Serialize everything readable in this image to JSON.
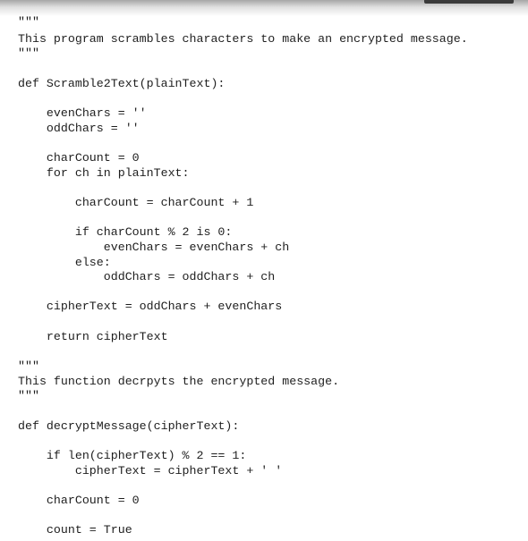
{
  "code": {
    "lines": [
      "\"\"\"",
      "This program scrambles characters to make an encrypted message.",
      "\"\"\"",
      "",
      "def Scramble2Text(plainText):",
      "",
      "    evenChars = ''",
      "    oddChars = ''",
      "",
      "    charCount = 0",
      "    for ch in plainText:",
      "",
      "        charCount = charCount + 1",
      "",
      "        if charCount % 2 is 0:",
      "            evenChars = evenChars + ch",
      "        else:",
      "            oddChars = oddChars + ch",
      "",
      "    cipherText = oddChars + evenChars",
      "",
      "    return cipherText",
      "",
      "\"\"\"",
      "This function decrpyts the encrypted message.",
      "\"\"\"",
      "",
      "def decryptMessage(cipherText):",
      "",
      "    if len(cipherText) % 2 == 1:",
      "        cipherText = cipherText + ' '",
      "",
      "    charCount = 0",
      "",
      "    count = True"
    ]
  }
}
